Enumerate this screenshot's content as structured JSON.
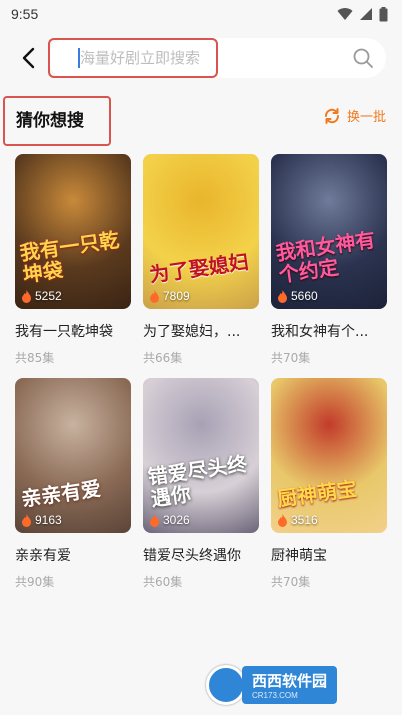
{
  "status_bar": {
    "time": "9:55"
  },
  "search": {
    "placeholder": "海量好剧立即搜索"
  },
  "section": {
    "title": "猜你想搜",
    "refresh_label": "换一批"
  },
  "cards": [
    {
      "title": "我有一只乾坤袋",
      "episodes": "共85集",
      "heat": "5252",
      "poster_text": "我有一只乾坤袋",
      "colors": [
        "#5a3a1e",
        "#c98a3a",
        "#3a2414"
      ]
    },
    {
      "title": "为了娶媳妇，...",
      "episodes": "共66集",
      "heat": "7809",
      "poster_text": "为了娶媳妇",
      "colors": [
        "#f3d24a",
        "#e9b52c",
        "#caa14a"
      ]
    },
    {
      "title": "我和女神有个...",
      "episodes": "共70集",
      "heat": "5660",
      "poster_text": "我和女神有个约定",
      "colors": [
        "#2b3350",
        "#6f7b9a",
        "#1c2238"
      ]
    },
    {
      "title": "亲亲有爱",
      "episodes": "共90集",
      "heat": "9163",
      "poster_text": "亲亲有爱",
      "colors": [
        "#8a6a55",
        "#c8b2a0",
        "#5a4438"
      ]
    },
    {
      "title": "错爱尽头终遇你",
      "episodes": "共60集",
      "heat": "3026",
      "poster_text": "错爱尽头终遇你",
      "colors": [
        "#d7d0d6",
        "#a8a1b5",
        "#6b6478"
      ]
    },
    {
      "title": "厨神萌宝",
      "episodes": "共70集",
      "heat": "3516",
      "poster_text": "厨神萌宝",
      "colors": [
        "#e8c86a",
        "#c23b2a",
        "#f2d08a"
      ]
    }
  ],
  "watermark": {
    "name": "西西软件园",
    "url": "CR173.COM"
  },
  "icons": {
    "back": "chevron-left-icon",
    "search": "search-icon",
    "refresh": "refresh-icon",
    "heat": "flame-icon"
  },
  "accent": "#f07a1f"
}
